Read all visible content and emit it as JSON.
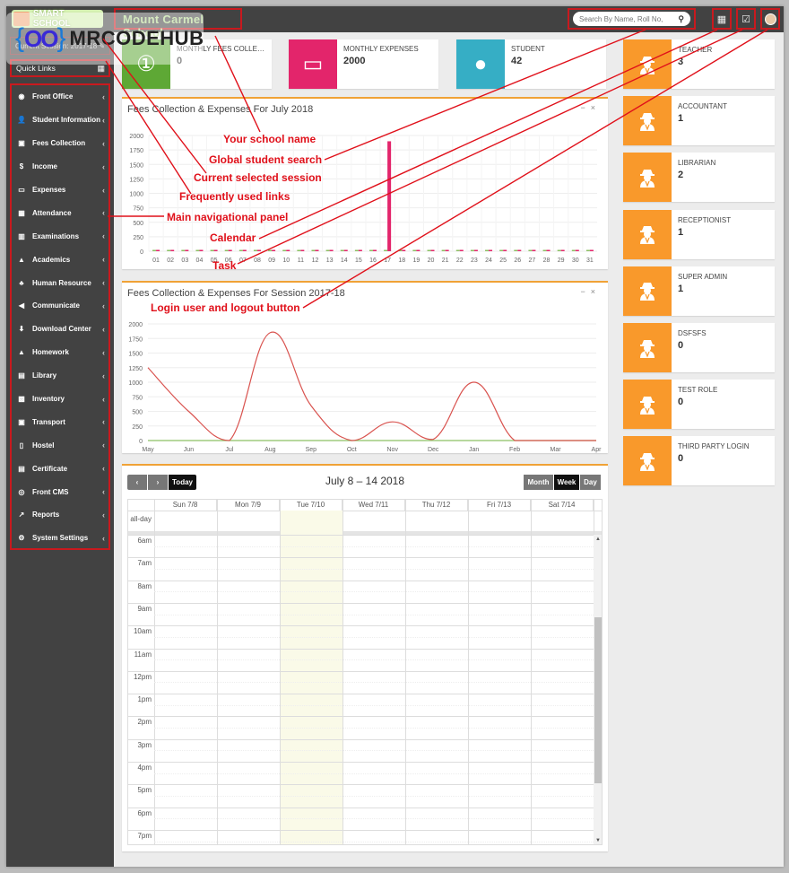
{
  "topbar": {
    "logo_text": "SMART SCHOOL",
    "school_name": "Mount Carmel School",
    "search_placeholder": "Search By Name, Roll No,",
    "icons": [
      "calendar-icon",
      "task-check-icon",
      "user-avatar-icon"
    ]
  },
  "watermark": {
    "symbol": "{OO}",
    "text": "MRCODEHUB"
  },
  "sidebar": {
    "session_label": "Current Session: 2017-18",
    "quick_links_label": "Quick Links",
    "items": [
      {
        "label": "Front Office",
        "icon": "front-office-icon",
        "glyph": "◉"
      },
      {
        "label": "Student Information",
        "icon": "student-info-icon",
        "glyph": "👤"
      },
      {
        "label": "Fees Collection",
        "icon": "fees-icon",
        "glyph": "▣"
      },
      {
        "label": "Income",
        "icon": "dollar-icon",
        "glyph": "$"
      },
      {
        "label": "Expenses",
        "icon": "credit-card-icon",
        "glyph": "▭"
      },
      {
        "label": "Attendance",
        "icon": "calendar-check-icon",
        "glyph": "▦"
      },
      {
        "label": "Examinations",
        "icon": "map-icon",
        "glyph": "▥"
      },
      {
        "label": "Academics",
        "icon": "graduation-cap-icon",
        "glyph": "▲"
      },
      {
        "label": "Human Resource",
        "icon": "sitemap-icon",
        "glyph": "♣"
      },
      {
        "label": "Communicate",
        "icon": "bullhorn-icon",
        "glyph": "◀"
      },
      {
        "label": "Download Center",
        "icon": "download-icon",
        "glyph": "⬇"
      },
      {
        "label": "Homework",
        "icon": "flask-icon",
        "glyph": "▲"
      },
      {
        "label": "Library",
        "icon": "book-icon",
        "glyph": "▤"
      },
      {
        "label": "Inventory",
        "icon": "inventory-icon",
        "glyph": "▩"
      },
      {
        "label": "Transport",
        "icon": "bus-icon",
        "glyph": "▣"
      },
      {
        "label": "Hostel",
        "icon": "building-icon",
        "glyph": "▯"
      },
      {
        "label": "Certificate",
        "icon": "certificate-icon",
        "glyph": "▤"
      },
      {
        "label": "Front CMS",
        "icon": "cms-icon",
        "glyph": "◎"
      },
      {
        "label": "Reports",
        "icon": "line-chart-icon",
        "glyph": "↗"
      },
      {
        "label": "System Settings",
        "icon": "cogs-icon",
        "glyph": "⚙"
      }
    ],
    "chevron": "‹"
  },
  "stats": [
    {
      "label": "MONTHLY FEES COLLEC...",
      "value": "0",
      "color": "#5ea835",
      "icon": "money-icon"
    },
    {
      "label": "MONTHLY EXPENSES",
      "value": "2000",
      "color": "#e3256b",
      "icon": "credit-card-icon"
    },
    {
      "label": "STUDENT",
      "value": "42",
      "color": "#36aec5",
      "icon": "user-icon"
    }
  ],
  "roles": [
    {
      "label": "TEACHER",
      "value": "3"
    },
    {
      "label": "ACCOUNTANT",
      "value": "1"
    },
    {
      "label": "LIBRARIAN",
      "value": "2"
    },
    {
      "label": "RECEPTIONIST",
      "value": "1"
    },
    {
      "label": "SUPER ADMIN",
      "value": "1"
    },
    {
      "label": "DSFSFS",
      "value": "0"
    },
    {
      "label": "TEST ROLE",
      "value": "0"
    },
    {
      "label": "THIRD PARTY LOGIN",
      "value": "0"
    }
  ],
  "role_color": "#f9992b",
  "panels": {
    "monthly_title": "Fees Collection & Expenses For July 2018",
    "session_title": "Fees Collection & Expenses For Session 2017-18",
    "minimize": "−",
    "close": "×"
  },
  "chart_data": [
    {
      "type": "bar",
      "title": "Fees Collection & Expenses For July 2018",
      "categories": [
        "01",
        "02",
        "03",
        "04",
        "05",
        "06",
        "07",
        "08",
        "09",
        "10",
        "11",
        "12",
        "13",
        "14",
        "15",
        "16",
        "17",
        "18",
        "19",
        "20",
        "21",
        "22",
        "23",
        "24",
        "25",
        "26",
        "27",
        "28",
        "29",
        "30",
        "31"
      ],
      "series": [
        {
          "name": "Fees Collection",
          "color": "#8cc063",
          "values": [
            0,
            0,
            0,
            0,
            0,
            0,
            0,
            0,
            0,
            0,
            0,
            0,
            0,
            0,
            0,
            0,
            0,
            0,
            0,
            0,
            0,
            0,
            0,
            0,
            0,
            0,
            0,
            0,
            0,
            0,
            0
          ]
        },
        {
          "name": "Expenses",
          "color": "#e3256b",
          "values": [
            0,
            0,
            0,
            0,
            0,
            0,
            0,
            0,
            0,
            0,
            0,
            0,
            0,
            0,
            0,
            0,
            1900,
            0,
            0,
            0,
            0,
            0,
            0,
            0,
            0,
            0,
            0,
            0,
            0,
            0,
            0
          ]
        }
      ],
      "yticks": [
        0,
        250,
        500,
        750,
        1000,
        1250,
        1500,
        1750,
        2000
      ],
      "ylim": [
        0,
        2000
      ],
      "grid": true,
      "xlabel": "",
      "ylabel": ""
    },
    {
      "type": "line",
      "title": "Fees Collection & Expenses For Session 2017-18",
      "categories": [
        "May",
        "Jun",
        "Jul",
        "Aug",
        "Sep",
        "Oct",
        "Nov",
        "Dec",
        "Jan",
        "Feb",
        "Mar",
        "Apr"
      ],
      "series": [
        {
          "name": "Expenses",
          "color": "#d9534f",
          "values": [
            1250,
            500,
            0,
            1850,
            600,
            0,
            320,
            20,
            1000,
            0,
            0,
            0
          ]
        },
        {
          "name": "Fees Collection",
          "color": "#8cc063",
          "values": [
            0,
            0,
            0,
            0,
            0,
            0,
            0,
            0,
            0,
            0,
            0,
            0
          ]
        }
      ],
      "yticks": [
        0,
        250,
        500,
        750,
        1000,
        1250,
        1500,
        1750,
        2000
      ],
      "ylim": [
        0,
        2000
      ],
      "grid": true,
      "xlabel": "",
      "ylabel": ""
    }
  ],
  "calendar": {
    "prev": "‹",
    "next": "›",
    "today": "Today",
    "title": "July 8 – 14 2018",
    "views": [
      "Month",
      "Week",
      "Day"
    ],
    "active_view": "Week",
    "days": [
      "Sun 7/8",
      "Mon 7/9",
      "Tue 7/10",
      "Wed 7/11",
      "Thu 7/12",
      "Fri 7/13",
      "Sat 7/14"
    ],
    "today_index": 2,
    "allday_label": "all-day",
    "times": [
      "6am",
      "7am",
      "8am",
      "9am",
      "10am",
      "11am",
      "12pm",
      "1pm",
      "2pm",
      "3pm",
      "4pm",
      "5pm",
      "6pm",
      "7pm"
    ]
  },
  "annotations": [
    "Your school name",
    "Global student search",
    "Current selected session",
    "Frequently used links",
    "Main navigational panel",
    "Calendar",
    "Task",
    "Login user and logout button"
  ]
}
